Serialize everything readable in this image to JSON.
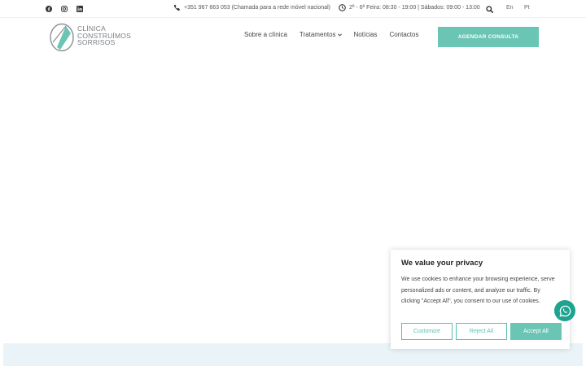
{
  "topbar": {
    "social": [
      {
        "icon": "facebook-icon"
      },
      {
        "icon": "instagram-icon"
      },
      {
        "icon": "linkedin-icon"
      }
    ],
    "phone": "+351 967 663 053 (Chamada para a rede móvel nacional)",
    "hours": "2ª - 6ª Feira: 08:30 - 19:00 | Sábados: 09:00 - 13:00",
    "languages": [
      "En",
      "Pt"
    ]
  },
  "header": {
    "logo_lines": [
      "CLÍNICA",
      "CONSTRUÍMOS",
      "SORRISOS"
    ],
    "nav": [
      {
        "label": "Sobre a clínica"
      },
      {
        "label": "Tratamentos"
      },
      {
        "label": "Notícias"
      },
      {
        "label": "Contactos"
      }
    ],
    "cta_label": "AGENDAR CONSULTA"
  },
  "cookie": {
    "title": "We value your privacy",
    "body": "We use cookies to enhance your browsing experience, serve personalized ads or content, and analyze our traffic. By clicking \"Accept All\", you consent to our use of cookies.",
    "customize_label": "Customize",
    "reject_label": "Reject All",
    "accept_label": "Accept All"
  },
  "colors": {
    "accent": "#6bc5b4",
    "whatsapp": "#1da38f",
    "band": "#eaf4f8"
  }
}
